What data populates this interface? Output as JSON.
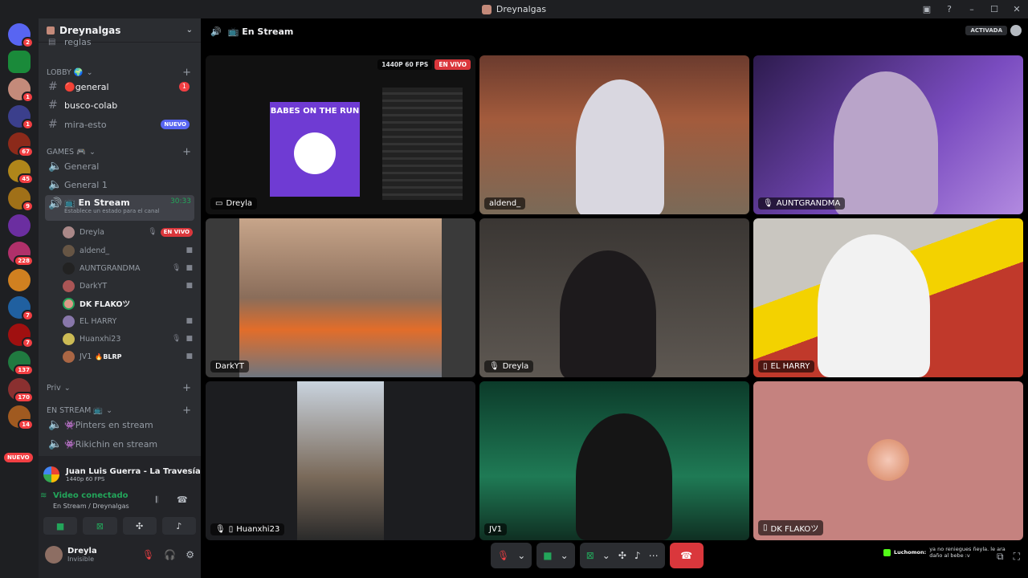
{
  "window": {
    "title": "Dreynalgas"
  },
  "server": {
    "name": "Dreynalgas",
    "partial_channel": "reglas"
  },
  "guild_badges": [
    "2",
    "1",
    "1",
    "67",
    "45",
    "9",
    "228",
    "7",
    "7",
    "137",
    "170",
    "14"
  ],
  "guild_nuevo": "NUEVO",
  "categories": {
    "lobby": "LOBBY 🌍",
    "games": "GAMES 🎮",
    "priv": "Priv",
    "en_stream": "EN STREAM 📺"
  },
  "channels": {
    "general": {
      "name": "🔴general",
      "badge": "1"
    },
    "busco_colab": {
      "name": "busco-colab"
    },
    "mira_esto": {
      "name": "mira-esto",
      "badge": "NUEVO"
    },
    "voice_general": {
      "name": "General"
    },
    "voice_general1": {
      "name": "General 1"
    },
    "en_stream": {
      "name": "📺 En Stream",
      "time": "30:33",
      "status": "Establece un estado para el canal"
    },
    "pinters": {
      "name": "👾Pinters en stream"
    },
    "rikichin": {
      "name": "👾Rikichin en stream"
    }
  },
  "voice_users": [
    {
      "name": "Dreyla",
      "live": "EN VIVO"
    },
    {
      "name": "aldend_"
    },
    {
      "name": "AUNTGRANDMA"
    },
    {
      "name": "DarkYT"
    },
    {
      "name": "DK FLAKOツ"
    },
    {
      "name": "EL HARRY"
    },
    {
      "name": "Huanxhi23"
    },
    {
      "name": "JV1",
      "tag": "🔥BLRP"
    }
  ],
  "now_playing": {
    "title": "Juan Luis Guerra - La Travesía...",
    "quality": "1440p 60 FPS"
  },
  "voice_panel": {
    "status": "Video conectado",
    "location": "En Stream / Dreynalgas"
  },
  "user_panel": {
    "name": "Dreyla",
    "status": "Invisible"
  },
  "stage": {
    "title": "📺 En Stream",
    "activada": "ACTIVADA"
  },
  "screen_share": {
    "quality": "1440P 60 FPS",
    "live": "EN VIVO",
    "art_title": "BABES ON THE RUN"
  },
  "tiles": [
    {
      "label": "Dreyla"
    },
    {
      "label": "aldend_"
    },
    {
      "label": "AUNTGRANDMA"
    },
    {
      "label": "DarkYT"
    },
    {
      "label": "Dreyla"
    },
    {
      "label": "EL HARRY"
    },
    {
      "label": "Huanxhi23"
    },
    {
      "label": "JV1"
    },
    {
      "label": "DK FLAKOツ"
    }
  ],
  "ticker": {
    "user": "Luchomon:",
    "text": "ya no reniegues ñeyla. le ara daño al bebe :v"
  },
  "colors": {
    "accent": "#5865f2",
    "danger": "#da373c",
    "online": "#23a55a"
  }
}
